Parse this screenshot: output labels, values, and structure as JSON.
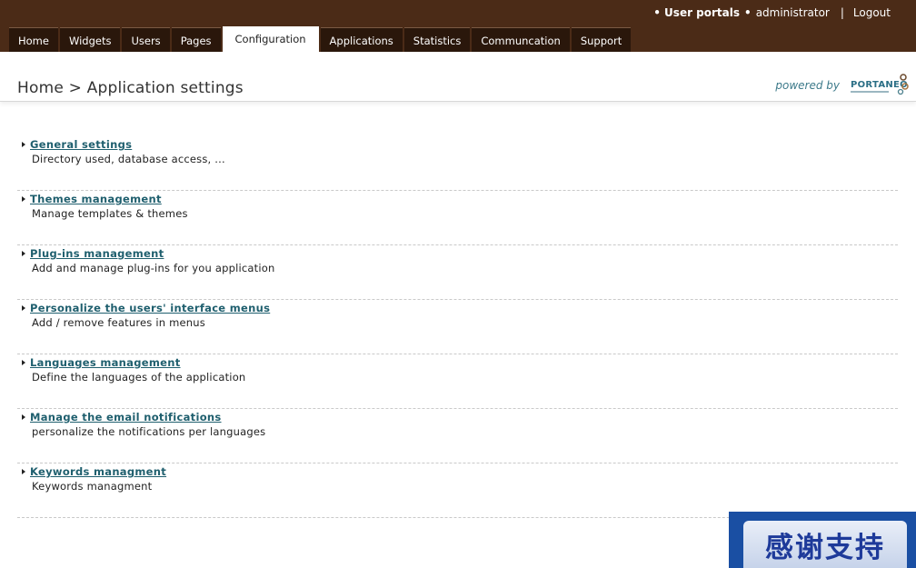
{
  "header": {
    "user_portals": "• User portals",
    "user_bullet": "•",
    "username": "administrator",
    "separator": "|",
    "logout": "Logout"
  },
  "tabs": [
    {
      "label": "Home",
      "active": false
    },
    {
      "label": "Widgets",
      "active": false
    },
    {
      "label": "Users",
      "active": false
    },
    {
      "label": "Pages",
      "active": false
    },
    {
      "label": "Configuration",
      "active": true
    },
    {
      "label": "Applications",
      "active": false
    },
    {
      "label": "Statistics",
      "active": false
    },
    {
      "label": "Communcation",
      "active": false
    },
    {
      "label": "Support",
      "active": false
    }
  ],
  "breadcrumb": "Home > Application settings",
  "powered": {
    "label": "powered by",
    "logo_text": "PORTANEO"
  },
  "settings": [
    {
      "title": "General settings",
      "desc": "Directory used, database access, ..."
    },
    {
      "title": "Themes management",
      "desc": "Manage templates & themes"
    },
    {
      "title": "Plug-ins management",
      "desc": "Add and manage plug-ins for you application"
    },
    {
      "title": "Personalize the users' interface menus",
      "desc": "Add / remove features in menus"
    },
    {
      "title": "Languages management",
      "desc": "Define the languages of the application"
    },
    {
      "title": "Manage the email notifications",
      "desc": "personalize the notifications per languages"
    },
    {
      "title": "Keywords managment",
      "desc": "Keywords managment"
    }
  ],
  "thanks_banner": "感谢支持",
  "colors": {
    "topbar": "#4b2b17",
    "tab": "#2a170b",
    "link": "#1f5f6e",
    "banner": "#1a4fa3"
  }
}
